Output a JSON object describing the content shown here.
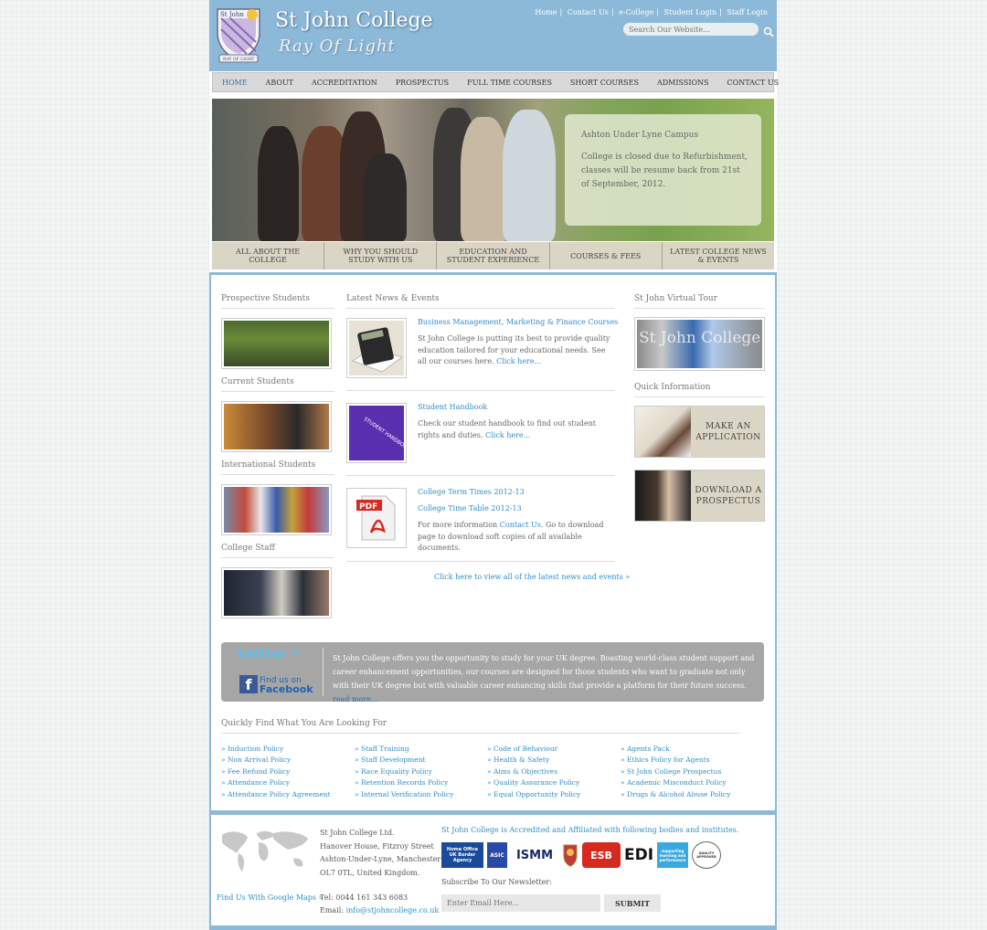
{
  "header": {
    "crest_text": "St John",
    "crest_motto": "RAY OF LIGHT",
    "site_title": "St John College",
    "tagline": "Ray Of Light",
    "toplinks": [
      "Home",
      "Contact Us",
      "e-College",
      "Student Login",
      "Staff Login"
    ],
    "search_placeholder": "Search Our Website..."
  },
  "nav": [
    "HOME",
    "ABOUT",
    "ACCREDITATION",
    "PROSPECTUS",
    "FULL TIME COURSES",
    "SHORT COURSES",
    "ADMISSIONS",
    "CONTACT US"
  ],
  "banner": {
    "heading": "Ashton Under Lyne Campus",
    "text": "College is closed due to Refurbishment, classes will be resume back from 21st of September, 2012."
  },
  "tabs": [
    "ALL ABOUT THE COLLEGE",
    "WHY YOU SHOULD STUDY WITH US",
    "EDUCATION AND STUDENT EXPERIENCE",
    "COURSES & FEES",
    "LATEST COLLEGE NEWS & EVENTS"
  ],
  "left_column": [
    "Prospective Students",
    "Current Students",
    "International Students",
    "College Staff"
  ],
  "news": {
    "heading": "Latest News & Events",
    "item1": {
      "title_a": "Business Management",
      "title_sep": ",",
      "title_b": "Marketing & Finance Courses",
      "body": "St John College is putting its best to provide quality education tailored for your educational needs. See all our courses here.",
      "link": "Click here..."
    },
    "item2": {
      "title": "Student Handbook",
      "body": "Check our student handbook to find out student rights and duties.",
      "link": "Click here...",
      "image_caption": "STUDENT HANDBOOK"
    },
    "item3": {
      "title1": "College Term Times 2012-13",
      "title2": "College Time Table 2012-13",
      "body_a": "For more information ",
      "body_link": "Contact Us",
      "body_b": ". Go to download page to download soft copies of all available documents.",
      "image_label": "PDF"
    },
    "all_link": "Click here to view all of the latest news and events »"
  },
  "right_column": {
    "tour_heading": "St John Virtual Tour",
    "tour_image_text": "St John College",
    "quick_heading": "Quick Information",
    "box1": "MAKE AN APPLICATION",
    "box2": "DOWNLOAD A PROSPECTUS"
  },
  "social": {
    "twitter": "twitter",
    "facebook_line1": "Find us on",
    "facebook_line2": "Facebook",
    "text": "St John College offers you the opportunity to study for your UK degree. Boasting world-class student support and career enhancement opportunities, our courses are designed for those students who want to graduate not only with their UK degree but with valuable career enhancing skills that provide a platform for their future success. ",
    "more": "read more..."
  },
  "quickfind": {
    "heading": "Quickly Find What You Are Looking For",
    "col1": [
      "» Induction Policy",
      "» Non Arrival Policy",
      "» Fee Refund Policy",
      "» Attendance Policy",
      "» Attendance Policy Agreement"
    ],
    "col2": [
      "» Staff Training",
      "» Staff Development",
      "» Race Equality Policy",
      "» Retention Records Policy",
      "» Internal Verification Policy"
    ],
    "col3": [
      "» Code of Behaviour",
      "» Health & Safety",
      "» Aims & Objectives",
      "» Quality Assurance Policy",
      "» Equal Opportunity Policy"
    ],
    "col4": [
      "» Agents Pack",
      "» Ethics Policy for Agents",
      "» St John College Prospectus",
      "» Academic Misconduct Policy",
      "» Drugs & Alcohol Abuse Policy"
    ]
  },
  "footer": {
    "address": [
      "St John College Ltd.",
      "Hanover House, Fitzroy Street",
      "Ashton-Under-Lyne, Manchester",
      "OL7 0TL, United Kingdom."
    ],
    "gmaps": "Find Us With Google Maps »",
    "tel": "Tel: 0044 161 343 6083",
    "email_label": "Email: ",
    "email": "info@stjohncollege.co.uk",
    "accr": "St John College is Accredited and Affiliated with following bodies and institutes.",
    "logos": [
      "Home Office UK Border Agency",
      "ASIC",
      "ISMM",
      "ESB",
      "EDI",
      "supporting learning and performance",
      "QUALITY APPROVED"
    ],
    "newsletter_heading": "Subscribe To Our Newsletter:",
    "newsletter_placeholder": "Enter Email Here...",
    "submit": "SUBMIT"
  },
  "colors": {
    "brand_blue": "#8db9d9",
    "link": "#2f8fc9",
    "tab_bg": "#dbd5c5"
  }
}
